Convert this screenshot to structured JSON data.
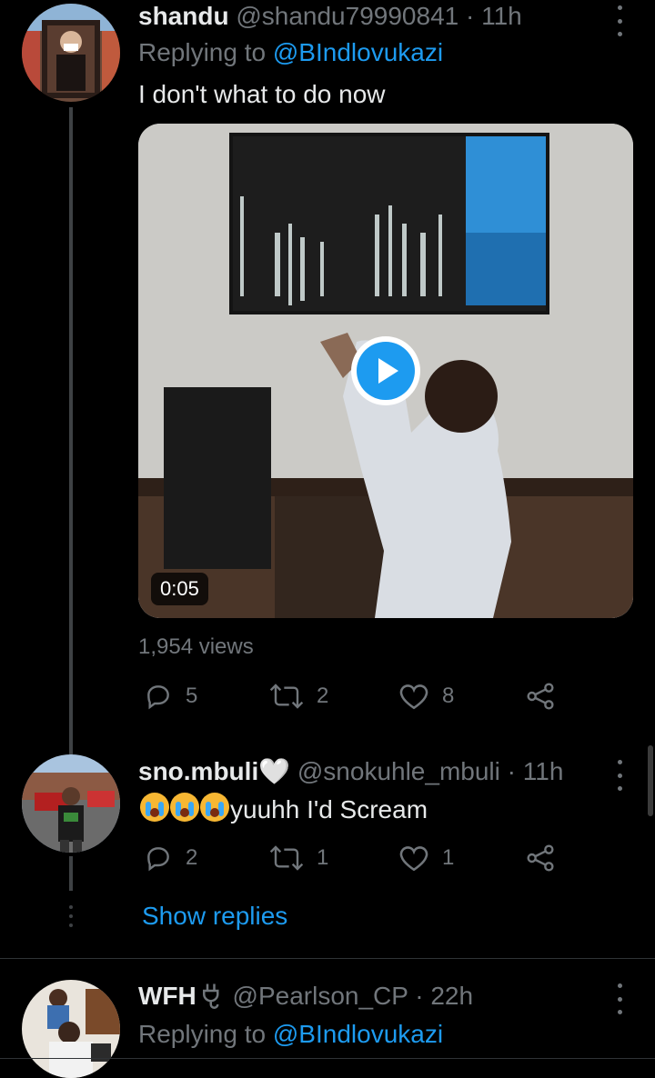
{
  "tweets": [
    {
      "name": "shandu",
      "handle": "@shandu79990841",
      "sep": "·",
      "time": "11h",
      "replying_prefix": "Replying to",
      "replying_to": "@BIndlovukazi",
      "text": "I don't what to do now",
      "video_duration": "0:05",
      "views": "1,954 views",
      "reply_count": "5",
      "retweet_count": "2",
      "like_count": "8"
    },
    {
      "name": "sno.mbuli🤍",
      "handle": "@snokuhle_mbuli",
      "sep": "·",
      "time": "11h",
      "text": "yuuhh I'd Scream",
      "reply_count": "2",
      "retweet_count": "1",
      "like_count": "1",
      "show_replies": "Show replies"
    },
    {
      "name": "WFH",
      "handle": "@Pearlson_CP",
      "sep": "·",
      "time": "22h",
      "replying_prefix": "Replying to",
      "replying_to": "@BIndlovukazi"
    }
  ],
  "icons": {
    "reply": "reply-icon",
    "retweet": "retweet-icon",
    "like": "heart-icon",
    "share": "share-icon",
    "more": "more-icon",
    "play": "play-icon"
  },
  "colors": {
    "background": "#000000",
    "text": "#e7e9ea",
    "muted": "#71767b",
    "accent": "#1d9bf0"
  }
}
